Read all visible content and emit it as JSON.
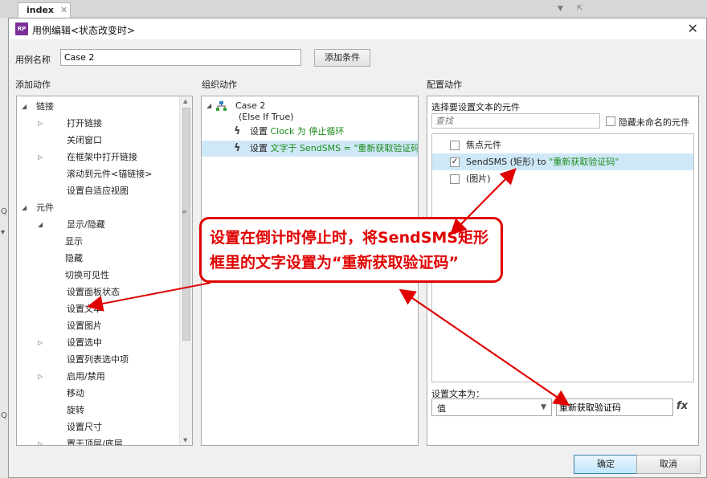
{
  "background_tab": {
    "label": "index",
    "close": "✕"
  },
  "dialog": {
    "title": "用例编辑<状态改变时>",
    "close": "✕",
    "case_name_label": "用例名称",
    "case_name_value": "Case 2",
    "add_condition_button": "添加条件",
    "ok_button": "确定",
    "cancel_button": "取消"
  },
  "add_actions": {
    "header": "添加动作",
    "items": [
      {
        "label": "链接",
        "level": 0,
        "toggle": "expanded"
      },
      {
        "label": "打开链接",
        "level": 1,
        "toggle": "collapsed"
      },
      {
        "label": "关闭窗口",
        "level": 1,
        "toggle": "none"
      },
      {
        "label": "在框架中打开链接",
        "level": 1,
        "toggle": "collapsed"
      },
      {
        "label": "滚动到元件<锚链接>",
        "level": 1,
        "toggle": "none"
      },
      {
        "label": "设置自适应视图",
        "level": 1,
        "toggle": "none"
      },
      {
        "label": "元件",
        "level": 0,
        "toggle": "expanded"
      },
      {
        "label": "显示/隐藏",
        "level": 1,
        "toggle": "expanded"
      },
      {
        "label": "显示",
        "level": 2,
        "toggle": "none"
      },
      {
        "label": "隐藏",
        "level": 2,
        "toggle": "none"
      },
      {
        "label": "切换可见性",
        "level": 2,
        "toggle": "none"
      },
      {
        "label": "设置面板状态",
        "level": 1,
        "toggle": "none"
      },
      {
        "label": "设置文本",
        "level": 1,
        "toggle": "none"
      },
      {
        "label": "设置图片",
        "level": 1,
        "toggle": "none"
      },
      {
        "label": "设置选中",
        "level": 1,
        "toggle": "collapsed"
      },
      {
        "label": "设置列表选中项",
        "level": 1,
        "toggle": "none"
      },
      {
        "label": "启用/禁用",
        "level": 1,
        "toggle": "collapsed"
      },
      {
        "label": "移动",
        "level": 1,
        "toggle": "none"
      },
      {
        "label": "旋转",
        "level": 1,
        "toggle": "none"
      },
      {
        "label": "设置尺寸",
        "level": 1,
        "toggle": "none"
      },
      {
        "label": "置于顶层/底层",
        "level": 1,
        "toggle": "collapsed"
      }
    ]
  },
  "organize_actions": {
    "header": "组织动作",
    "case_label": "Case 2",
    "case_condition": "(Else If True)",
    "actions": [
      {
        "prefix": "设置 ",
        "target": "Clock 为 停止循环",
        "selected": false
      },
      {
        "prefix": "设置 ",
        "target": "文字于 SendSMS = \"重新获取验证码\"",
        "selected": true
      }
    ]
  },
  "configure_actions": {
    "header": "配置动作",
    "select_widgets_label": "选择要设置文本的元件",
    "search_placeholder": "查找",
    "hide_unnamed_label": "隐藏未命名的元件",
    "widgets": [
      {
        "label": "焦点元件",
        "checked": false,
        "selected": false,
        "suffix": ""
      },
      {
        "label": "SendSMS (矩形) to ",
        "checked": true,
        "selected": true,
        "suffix": "\"重新获取验证码\""
      },
      {
        "label": "(图片)",
        "checked": false,
        "selected": false,
        "suffix": ""
      }
    ],
    "set_text_label": "设置文本为：",
    "value_type": "值",
    "value_text": "重新获取验证码",
    "fx_label": "fx"
  },
  "annotation": {
    "line1": "设置在倒计时停止时，将SendSMS矩形",
    "line2": "框里的文字设置为“重新获取验证码”",
    "color": "#e10000"
  }
}
